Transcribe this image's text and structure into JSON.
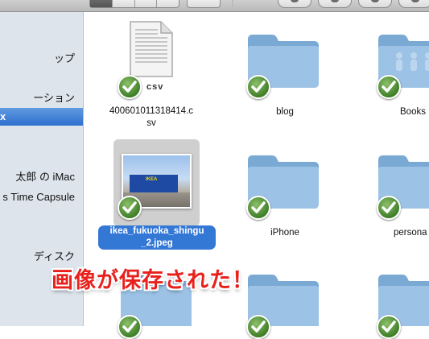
{
  "sidebar": {
    "items": [
      {
        "label": "ップ"
      },
      {
        "label": "ーション"
      },
      {
        "label": "x",
        "selected": true
      },
      {
        "label": "太郎 の iMac"
      },
      {
        "label": "s Time Capsule"
      },
      {
        "label": "ディスク"
      }
    ]
  },
  "files": [
    {
      "name_line1": "400601011318414.c",
      "name_line2": "sv",
      "type": "csv",
      "badge": "csv"
    },
    {
      "name": "blog",
      "type": "folder"
    },
    {
      "name": "Books",
      "type": "folder"
    },
    {
      "name_line1": "ikea_fukuoka_shingu",
      "name_line2": "_2.jpeg",
      "type": "image",
      "selected": true,
      "image_text": "IKEA"
    },
    {
      "name": "iPhone",
      "type": "folder"
    },
    {
      "name": "persona",
      "type": "folder"
    }
  ],
  "caption": "画像が保存された！",
  "colors": {
    "folder": "#8fb8dd",
    "selection": "#3478d6",
    "caption": "#e8211c",
    "check": "#4b8a2f"
  }
}
